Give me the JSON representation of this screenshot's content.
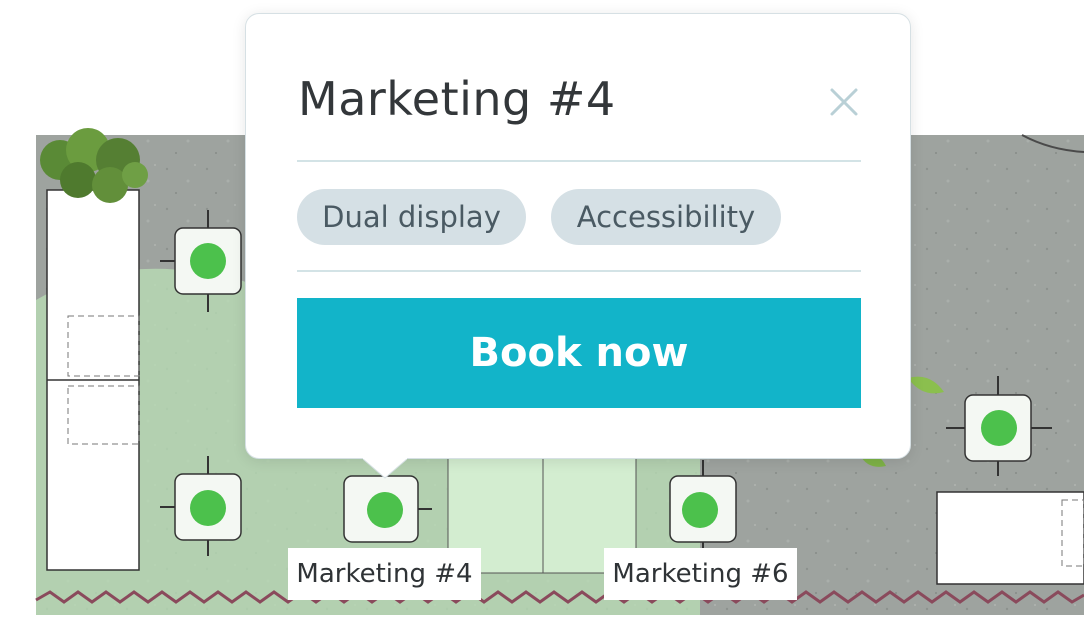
{
  "popup": {
    "title": "Marketing #4",
    "close_icon": "close-icon",
    "amenities": [
      "Dual display",
      "Accessibility"
    ],
    "book_button_label": "Book now"
  },
  "desks": {
    "labels": [
      "Marketing #4",
      "Marketing #6"
    ]
  },
  "colors": {
    "accent": "#12b4c9",
    "chip_bg": "#d5e0e5",
    "available": "#4cc14c",
    "floor": "#9aa09c",
    "zone": "#c9e8c6"
  }
}
